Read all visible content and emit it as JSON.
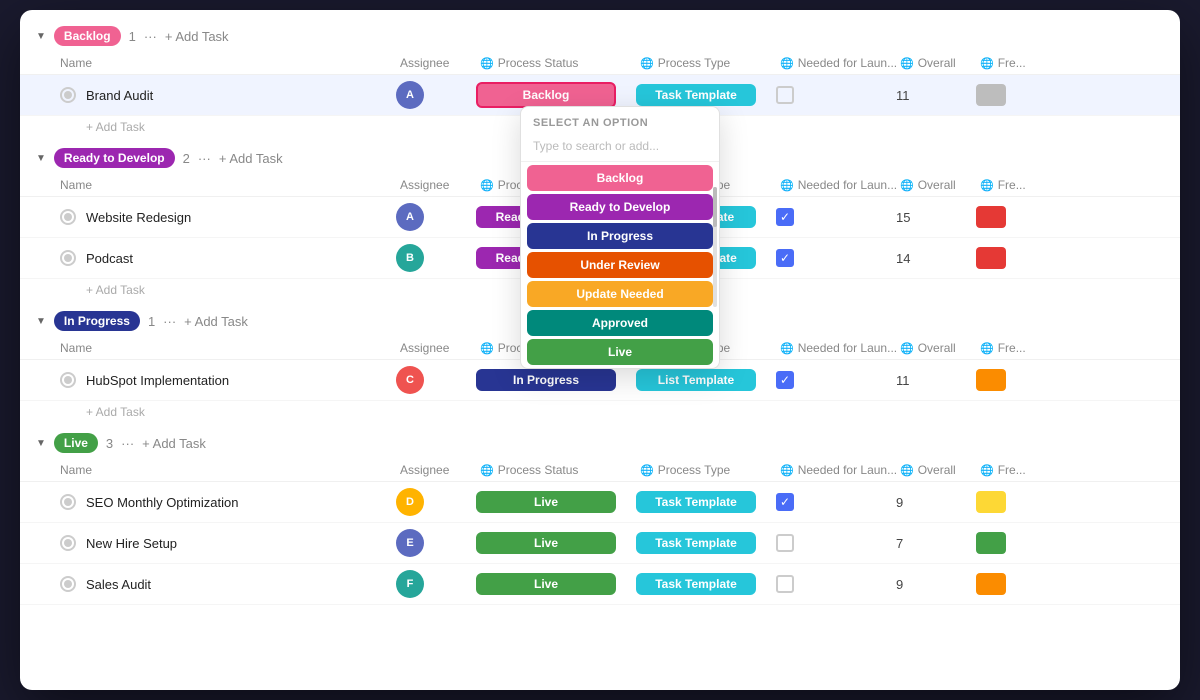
{
  "colors": {
    "backlog": "#f06292",
    "backlogBg": "#f06292",
    "ready": "#9c27b0",
    "readyBg": "#9c27b0",
    "inProgress": "#1a237e",
    "inProgressBg": "#283593",
    "underReview": "#e65100",
    "underReviewBg": "#e65100",
    "updateNeeded": "#f9a825",
    "updateNeededBg": "#f9a825",
    "approved": "#00897b",
    "approvedBg": "#00897b",
    "live": "#43a047",
    "liveBg": "#43a047",
    "taskTemplate": "#26c6da",
    "listTemplate": "#26c6da",
    "redBar": "#e53935",
    "orangeBar": "#fb8c00",
    "yellowBar": "#fdd835",
    "greenBar": "#43a047",
    "grayBar": "#bdbdbd"
  },
  "sections": [
    {
      "id": "backlog",
      "label": "Backlog",
      "color": "#f06292",
      "count": 1,
      "tasks": [
        {
          "name": "Brand Audit",
          "assigneeColor": "#5c6bc0",
          "assigneeInitial": "A",
          "status": "Backlog",
          "statusColor": "#f06292",
          "statusBorder": true,
          "type": "Task Template",
          "typeColor": "#26c6da",
          "launchChecked": false,
          "overall": 11,
          "barColor": "#bdbdbd"
        }
      ]
    },
    {
      "id": "ready",
      "label": "Ready to Develop",
      "color": "#9c27b0",
      "count": 2,
      "tasks": [
        {
          "name": "Website Redesign",
          "assigneeColor": "#5c6bc0",
          "assigneeInitial": "A",
          "status": "Ready to Develop",
          "statusColor": "#9c27b0",
          "statusBorder": false,
          "type": "List Template",
          "typeColor": "#26c6da",
          "launchChecked": true,
          "overall": 15,
          "barColor": "#e53935"
        },
        {
          "name": "Podcast",
          "assigneeColor": "#26a69a",
          "assigneeInitial": "B",
          "status": "Ready to Develop",
          "statusColor": "#9c27b0",
          "statusBorder": false,
          "type": "Task Template",
          "typeColor": "#26c6da",
          "launchChecked": true,
          "overall": 14,
          "barColor": "#e53935"
        }
      ]
    },
    {
      "id": "inProgress",
      "label": "In Progress",
      "color": "#283593",
      "count": 1,
      "tasks": [
        {
          "name": "HubSpot Implementation",
          "assigneeColor": "#ef5350",
          "assigneeInitial": "C",
          "status": "In Progress",
          "statusColor": "#283593",
          "statusBorder": false,
          "type": "List Template",
          "typeColor": "#26c6da",
          "launchChecked": true,
          "overall": 11,
          "barColor": "#fb8c00"
        }
      ]
    },
    {
      "id": "live",
      "label": "Live",
      "color": "#43a047",
      "count": 3,
      "tasks": [
        {
          "name": "SEO Monthly Optimization",
          "assigneeColor": "#ffb300",
          "assigneeInitial": "D",
          "status": "Live",
          "statusColor": "#43a047",
          "statusBorder": false,
          "type": "Task Template",
          "typeColor": "#26c6da",
          "launchChecked": true,
          "overall": 9,
          "barColor": "#fdd835"
        },
        {
          "name": "New Hire Setup",
          "assigneeColor": "#5c6bc0",
          "assigneeInitial": "E",
          "status": "Live",
          "statusColor": "#43a047",
          "statusBorder": false,
          "type": "Task Template",
          "typeColor": "#26c6da",
          "launchChecked": false,
          "overall": 7,
          "barColor": "#43a047"
        },
        {
          "name": "Sales Audit",
          "assigneeColor": "#26a69a",
          "assigneeInitial": "F",
          "status": "Live",
          "statusColor": "#43a047",
          "statusBorder": false,
          "type": "Task Template",
          "typeColor": "#26c6da",
          "launchChecked": false,
          "overall": 9,
          "barColor": "#fb8c00"
        }
      ]
    }
  ],
  "columns": {
    "name": "Name",
    "assignee": "Assignee",
    "processStatus": "Process Status",
    "processType": "Process Type",
    "neededForLaunch": "Needed for Laun...",
    "overall": "Overall",
    "freq": "Freq"
  },
  "dropdown": {
    "header": "SELECT AN OPTION",
    "placeholder": "Type to search or add...",
    "options": [
      {
        "label": "Backlog",
        "color": "#f06292"
      },
      {
        "label": "Ready to Develop",
        "color": "#9c27b0"
      },
      {
        "label": "In Progress",
        "color": "#283593"
      },
      {
        "label": "Under Review",
        "color": "#e65100"
      },
      {
        "label": "Update Needed",
        "color": "#f9a825"
      },
      {
        "label": "Approved",
        "color": "#00897b"
      },
      {
        "label": "Live",
        "color": "#43a047"
      }
    ]
  },
  "addTask": "+ Add Task",
  "addSubtask": "+ Add Task"
}
